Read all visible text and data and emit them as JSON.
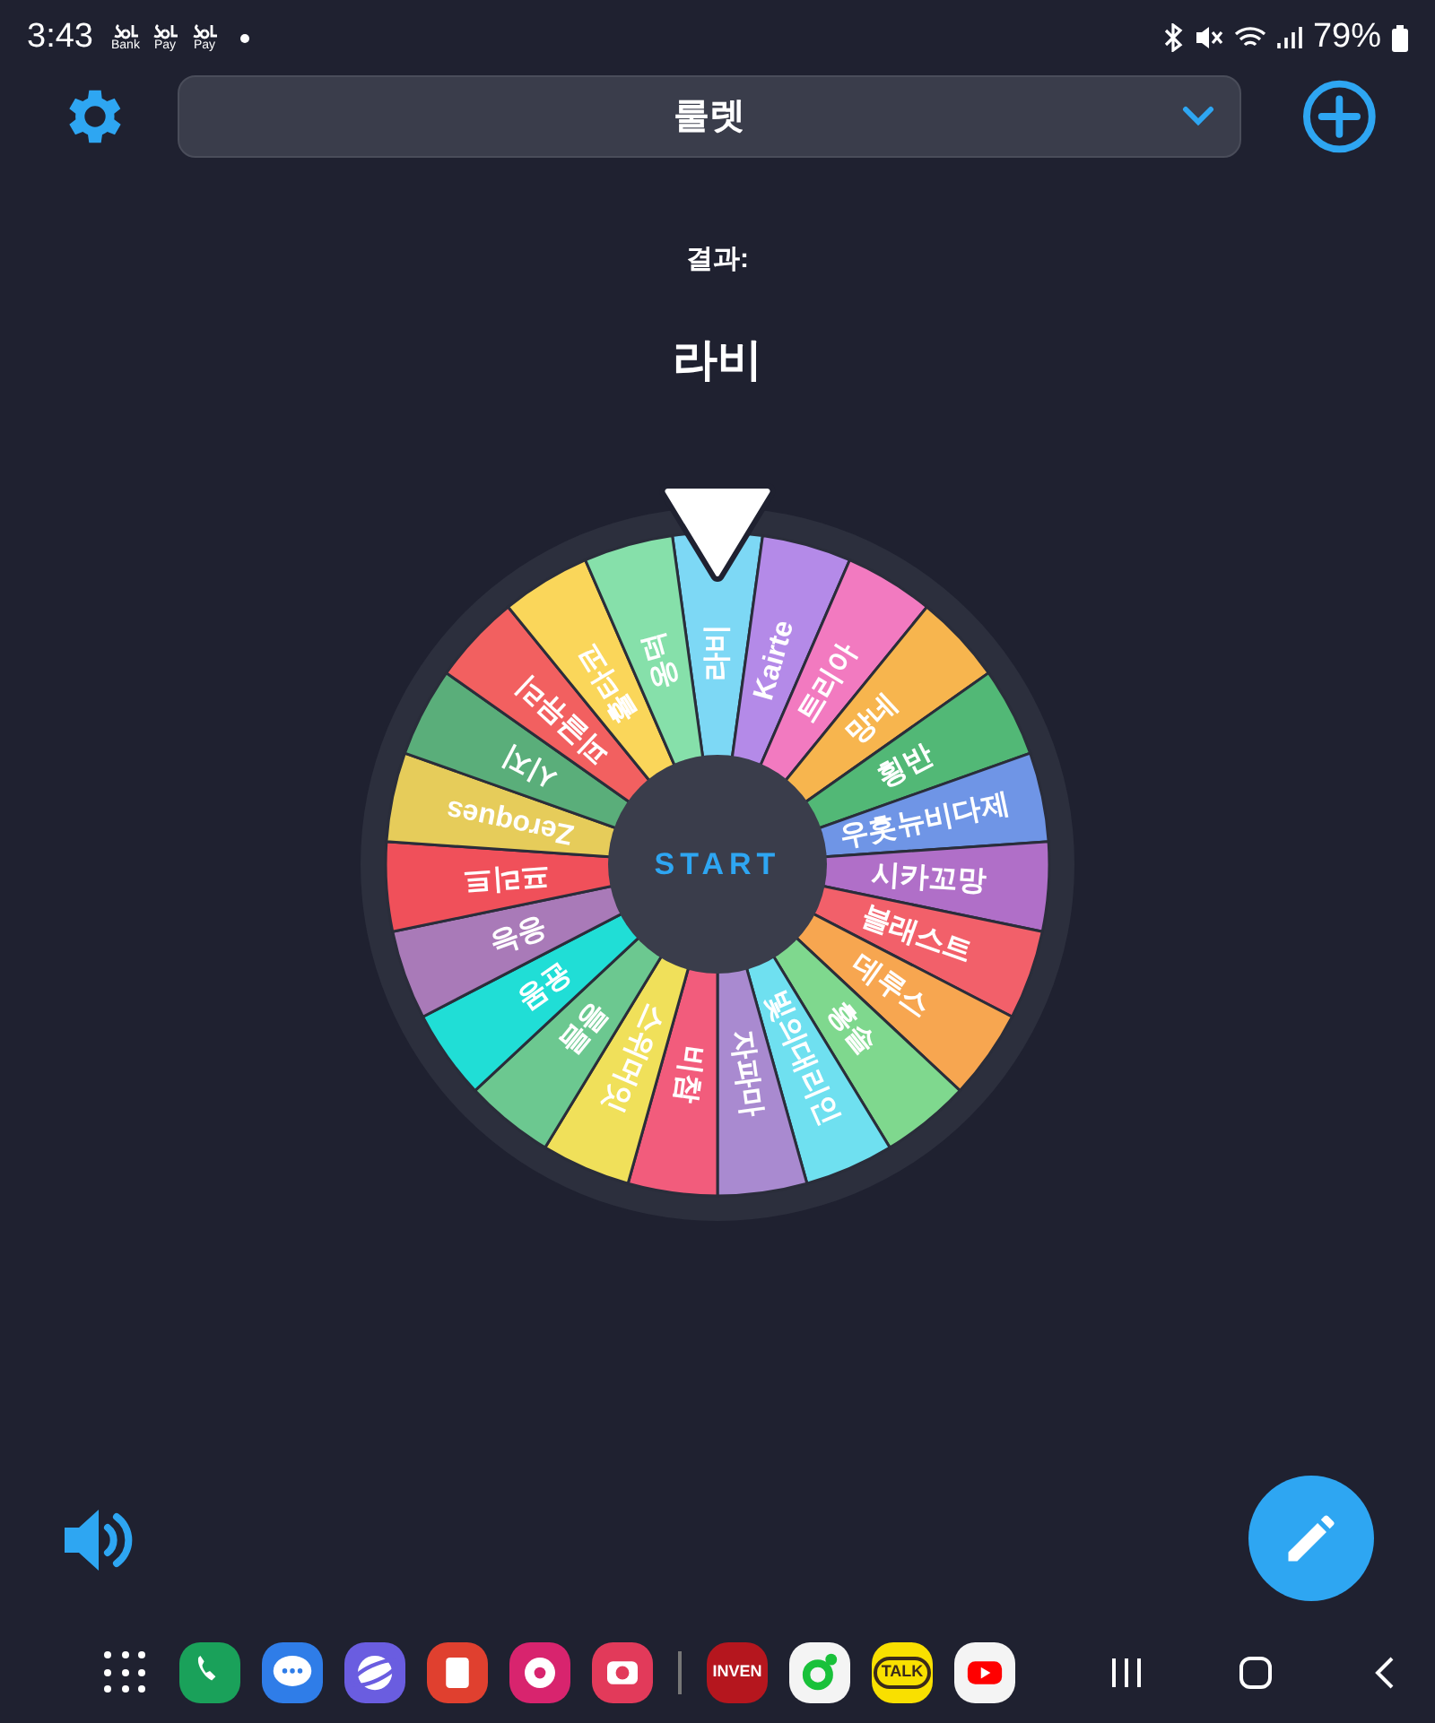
{
  "status_bar": {
    "time": "3:43",
    "notification_icons": [
      {
        "kind": "sol",
        "label": "Bank"
      },
      {
        "kind": "sol",
        "label": "Pay"
      },
      {
        "kind": "sol",
        "label": "Pay"
      },
      {
        "kind": "dot"
      }
    ],
    "battery": "79%"
  },
  "header": {
    "title": "룰렛"
  },
  "result": {
    "label": "결과:",
    "value": "라비"
  },
  "wheel": {
    "start_label": "START",
    "segments": [
      {
        "label": "라비",
        "color": "#7dd8f5"
      },
      {
        "label": "Kairte",
        "color": "#b48ae8"
      },
      {
        "label": "트리아",
        "color": "#f27ac0"
      },
      {
        "label": "망네",
        "color": "#f7b54e"
      },
      {
        "label": "횡반",
        "color": "#52b876"
      },
      {
        "label": "우홋뉴비다제",
        "color": "#6f95e6"
      },
      {
        "label": "시카꼬망",
        "color": "#b06fc8"
      },
      {
        "label": "블래스트",
        "color": "#f2606a"
      },
      {
        "label": "데루스",
        "color": "#f7a650"
      },
      {
        "label": "홍솔",
        "color": "#7fd88e"
      },
      {
        "label": "빛의대리인",
        "color": "#6fe0f0"
      },
      {
        "label": "자파마",
        "color": "#a98ad0"
      },
      {
        "label": "비참",
        "color": "#f25c7c"
      },
      {
        "label": "스위머잇",
        "color": "#f0e05a"
      },
      {
        "label": "릉름",
        "color": "#6cc890"
      },
      {
        "label": "윤몽",
        "color": "#20ded6"
      },
      {
        "label": "응능",
        "color": "#a97ab8"
      },
      {
        "label": "프리트",
        "color": "#f0505a"
      },
      {
        "label": "Zeroques",
        "color": "#e6cc5a"
      },
      {
        "label": "시지",
        "color": "#5aae7a"
      },
      {
        "label": "피글뮤리",
        "color": "#f26060"
      },
      {
        "label": "휼타코",
        "color": "#fad65a"
      },
      {
        "label": "옹덕",
        "color": "#86e0aa"
      }
    ]
  },
  "dock": [
    {
      "kind": "apps"
    },
    {
      "kind": "phone"
    },
    {
      "kind": "messages"
    },
    {
      "kind": "internet"
    },
    {
      "kind": "notes"
    },
    {
      "kind": "flower"
    },
    {
      "kind": "camera"
    },
    {
      "kind": "divider"
    },
    {
      "kind": "badge",
      "label": "INVEN"
    },
    {
      "kind": "ring"
    },
    {
      "kind": "talk",
      "label": "TALK"
    },
    {
      "kind": "play"
    },
    {
      "kind": "recents"
    },
    {
      "kind": "home"
    },
    {
      "kind": "back"
    }
  ]
}
